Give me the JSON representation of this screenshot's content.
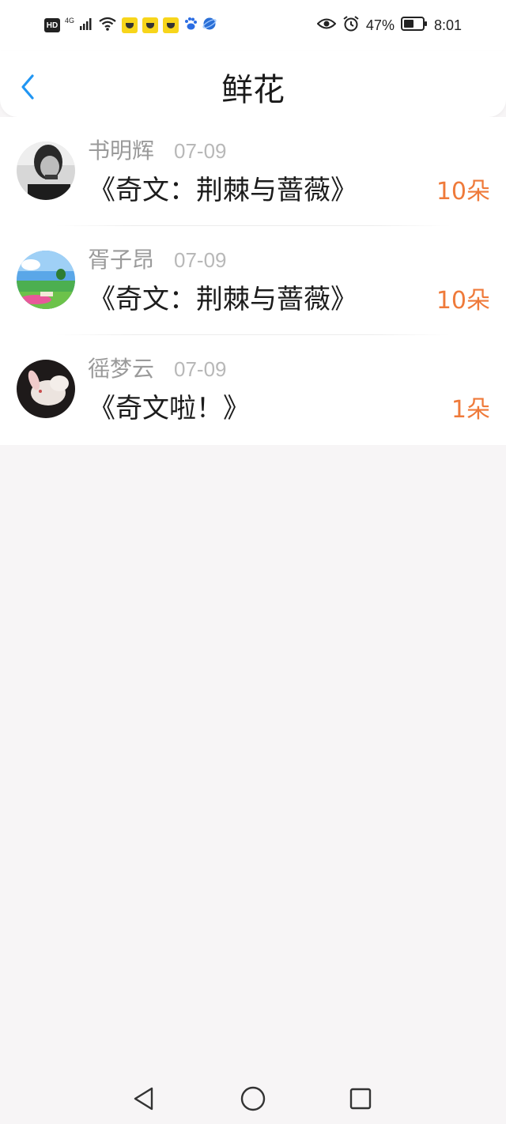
{
  "status_bar": {
    "network_label": "4G",
    "battery": "47%",
    "time": "8:01",
    "hd_label": "HD",
    "icons": [
      "hd-icon",
      "signal-icon",
      "wifi-icon",
      "app-notification-icon",
      "app-notification-icon",
      "app-notification-icon",
      "baidu-icon",
      "browser-icon",
      "eye-icon",
      "alarm-icon",
      "battery-icon"
    ],
    "colors": {
      "app_notification": "#f7d51b",
      "baidu": "#2b6de3",
      "browser": "#2a6fd6"
    }
  },
  "header": {
    "title": "鲜花",
    "back_icon": "chevron-left-icon",
    "back_color": "#2196f3"
  },
  "flowers": [
    {
      "user": "书明辉",
      "date": "07-09",
      "title": "《奇文：荆棘与蔷薇》",
      "count": "10朵"
    },
    {
      "user": "胥子昂",
      "date": "07-09",
      "title": "《奇文：荆棘与蔷薇》",
      "count": "10朵"
    },
    {
      "user": "徭梦云",
      "date": "07-09",
      "title": "《奇文啦！》",
      "count": "1朵"
    }
  ],
  "nav": {
    "icons": [
      "back-triangle-icon",
      "home-circle-icon",
      "recents-square-icon"
    ]
  },
  "colors": {
    "count": "#ef7a3a",
    "accent": "#2196f3"
  }
}
